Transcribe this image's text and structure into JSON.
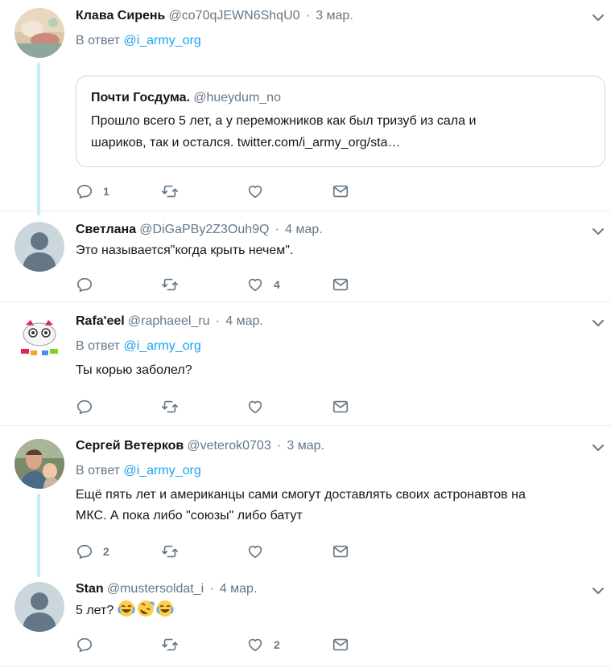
{
  "tweets": [
    {
      "name": "Клава Сирень",
      "handle": "@co70qJEWN6ShqU0",
      "date": "3 мар.",
      "reply_prefix": "В ответ ",
      "reply_to": "@i_army_org",
      "reply_count": "1",
      "quote": {
        "name": "Почти Госдума.",
        "handle": "@hueydum_no",
        "line1": "Прошло всего 5 лет, а у переможников как был тризуб из сала и",
        "line2": "шариков, так и остался. twitter.com/i_army_org/sta…"
      }
    },
    {
      "name": "Светлана",
      "handle": "@DiGaPBy2Z3Ouh9Q",
      "date": "4 мар.",
      "text": "Это называется\"когда крыть нечем\".",
      "like_count": "4"
    },
    {
      "name": "Rafa'eel",
      "handle": "@raphaeel_ru",
      "date": "4 мар.",
      "reply_prefix": "В ответ ",
      "reply_to": "@i_army_org",
      "text": "Ты корью заболел?"
    },
    {
      "name": "Сергей Ветерков",
      "handle": "@veterok0703",
      "date": "3 мар.",
      "reply_prefix": "В ответ ",
      "reply_to": "@i_army_org",
      "line1": "Ещё пять лет и американцы сами смогут доставлять своих астронавтов на",
      "line2": "МКС. А пока либо \"союзы\" либо батут",
      "reply_count": "2"
    },
    {
      "name": "Stan",
      "handle": "@mustersoldat_i",
      "date": "4 мар.",
      "text": "5 лет?",
      "emojis": [
        "face-with-tears-of-joy",
        "rolling-on-floor-laughing",
        "face-with-tears-of-joy"
      ],
      "like_count": "2"
    }
  ],
  "ui": {
    "dot": "·",
    "icons": [
      "reply-icon",
      "retweet-icon",
      "like-icon",
      "message-icon",
      "chevron-down-icon"
    ],
    "colors": {
      "link": "#1da1f2",
      "muted": "#657786",
      "thread": "#c4eafb",
      "border": "#e6ecf0"
    }
  }
}
